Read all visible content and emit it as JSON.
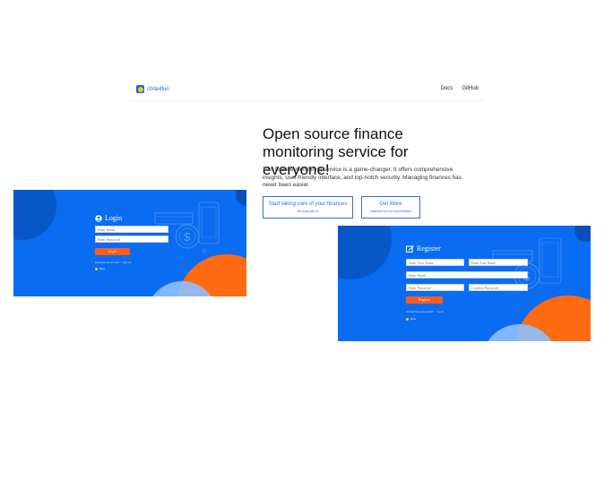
{
  "navbar": {
    "brand": "c0de4fun",
    "links": [
      "Docs",
      "GitHub"
    ]
  },
  "hero": {
    "title": "Open source finance monitoring service for everyone!",
    "description": "This finance monitoring service is a game-changer. It offers comprehensive insights, user-friendly interface, and top-notch security. Managing finances has never been easier.",
    "primary_button": {
      "label": "Start taking care of your finances",
      "sub": "Be ready with us"
    },
    "secondary_button": {
      "label": "Get More",
      "sub": "Additional info for documentation"
    }
  },
  "login_panel": {
    "title": "Login",
    "email_placeholder": "Enter Email",
    "password_placeholder": "Enter Password",
    "submit": "Login",
    "footer_text": "Dont have an account?",
    "footer_link": "Sign Up",
    "remember": "Back"
  },
  "register_panel": {
    "title": "Register",
    "first_name_placeholder": "Enter First Name",
    "last_name_placeholder": "Enter Last Name",
    "email_placeholder": "Enter Email",
    "password_placeholder": "Enter Password",
    "confirm_placeholder": "Confirm Password",
    "submit": "Register",
    "footer_text": "Already have an account?",
    "footer_link": "Log In",
    "remember": "Back"
  },
  "colors": {
    "panel_blue": "#0a6cf0",
    "accent_orange": "#ff5a1f",
    "link_blue": "#2f6fe0"
  },
  "icons": [
    "brand-logo-icon",
    "user-circle-icon",
    "edit-icon",
    "phone-illustration-icon",
    "dollar-coin-icon",
    "credit-card-icon"
  ]
}
